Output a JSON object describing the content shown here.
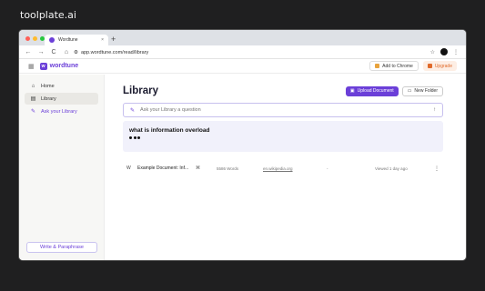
{
  "brand": "toolplate.ai",
  "browser": {
    "tab_title": "Wordtune",
    "tab_close": "×",
    "new_tab": "+",
    "url": "app.wordtune.com/read/library",
    "nav": {
      "back": "←",
      "forward": "→",
      "reload": "C",
      "home": "⌂"
    },
    "star": "☆",
    "menu": "⋮"
  },
  "appbar": {
    "grid_icon": "grid-icon",
    "logo_text": "wordtune",
    "logo_mark": "w",
    "add_to_chrome": "Add to Chrome",
    "upgrade": "Upgrade",
    "colors": {
      "brand": "#6b3fd8",
      "upgrade": "#e06a2a"
    }
  },
  "sidebar": {
    "items": [
      {
        "label": "Home",
        "icon": "⌂",
        "icon_name": "home-icon"
      },
      {
        "label": "Library",
        "icon": "▤",
        "icon_name": "library-icon"
      },
      {
        "label": "Ask your Library",
        "icon": "✎",
        "icon_name": "ask-library-icon"
      }
    ],
    "write_button": "Write & Paraphrase"
  },
  "main": {
    "title": "Library",
    "upload_button": "Upload Document",
    "new_folder_button": "New Folder",
    "ask_placeholder": "Ask your Library a question",
    "answer_question": "what is information overload",
    "documents": [
      {
        "icon": "W",
        "name": "Example Document: Inf...",
        "link_icon": "⌘",
        "words": "5586 Words",
        "source": "en.wikipedia.org",
        "dash": "-",
        "viewed": "Viewed 1 day ago",
        "more": "⋮"
      }
    ]
  }
}
